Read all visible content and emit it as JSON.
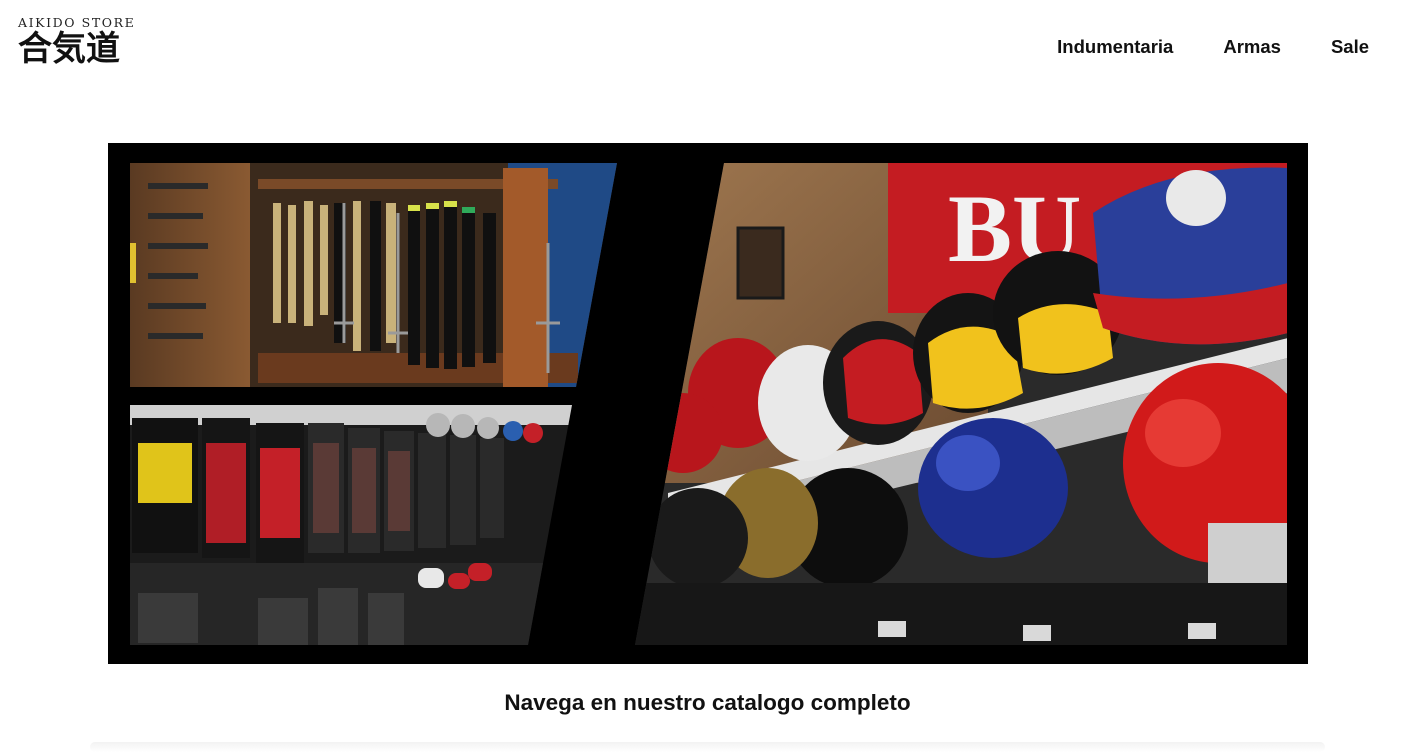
{
  "header": {
    "logo_top": "AIKIDO STORE",
    "logo_kanji": "合気道"
  },
  "nav": {
    "items": [
      {
        "label": "Indumentaria"
      },
      {
        "label": "Armas"
      },
      {
        "label": "Sale"
      }
    ]
  },
  "hero": {
    "signage_text": "BU"
  },
  "catalog": {
    "heading": "Navega en nuestro catalogo completo"
  },
  "colors": {
    "hero_frame": "#000000",
    "text": "#111111"
  }
}
